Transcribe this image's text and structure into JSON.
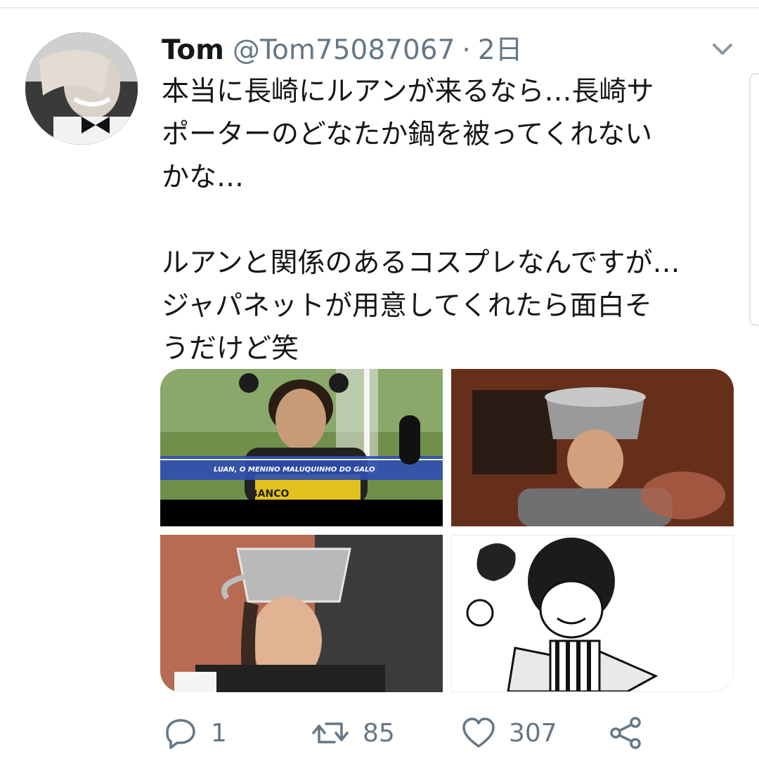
{
  "tweet": {
    "author_name": "Tom",
    "handle": "@Tom75087067",
    "separator": "·",
    "timestamp": "2日",
    "text": "本当に長崎にルアンが来るなら…長崎サ\nポーターのどなたか鍋を被ってくれない\nかな…\n\nルアンと関係のあるコスプレなんですが…\nジャパネットが用意してくれたら面白そ\nうだけど笑"
  },
  "media": {
    "image1_caption": "LUAN, O MENINO MALUQUINHO DO GALO",
    "image1_shirt_text": "BANCO"
  },
  "actions": {
    "reply_count": "1",
    "retweet_count": "85",
    "like_count": "307"
  },
  "icons": {
    "reply": "reply-icon",
    "retweet": "retweet-icon",
    "like": "heart-icon",
    "share": "share-icon",
    "menu": "chevron-down-icon"
  },
  "colors": {
    "text": "#14171a",
    "muted": "#657786",
    "divider": "#e6ecf0"
  }
}
